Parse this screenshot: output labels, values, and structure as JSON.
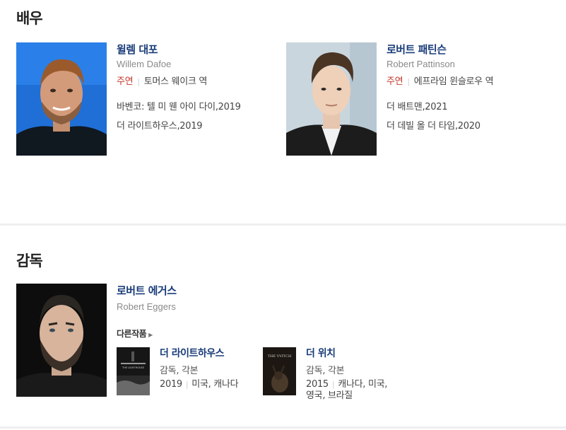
{
  "actors_section": {
    "title": "배우",
    "actors": [
      {
        "name_ko": "윌렘 대포",
        "name_en": "Willem Dafoe",
        "role_type": "주연",
        "role_name": "토머스 웨이크 역",
        "works": [
          "바벤코: 텔 미 웬 아이 다이,2019",
          "더 라이트하우스,2019"
        ]
      },
      {
        "name_ko": "로버트 패틴슨",
        "name_en": "Robert Pattinson",
        "role_type": "주연",
        "role_name": "에프라임 윈슬로우 역",
        "works": [
          "더 배트맨,2021",
          "더 데빌 올 더 타임,2020"
        ]
      }
    ]
  },
  "director_section": {
    "title": "감독",
    "director": {
      "name_ko": "로버트 에거스",
      "name_en": "Robert Eggers"
    },
    "other_works_label": "다른작품",
    "films": [
      {
        "title": "더 라이트하우스",
        "role": "감독, 각본",
        "year": "2019",
        "country": "미국, 캐나다",
        "poster_text": "THE LIGHTHOUSE"
      },
      {
        "title": "더 위치",
        "role": "감독, 각본",
        "year": "2015",
        "country": "캐나다, 미국, 영국, 브라질",
        "poster_text": "THE VVITCH"
      }
    ]
  },
  "colors": {
    "name_link": "#1a3c7a",
    "role_type": "#c0392b",
    "divider": "#efefef"
  }
}
